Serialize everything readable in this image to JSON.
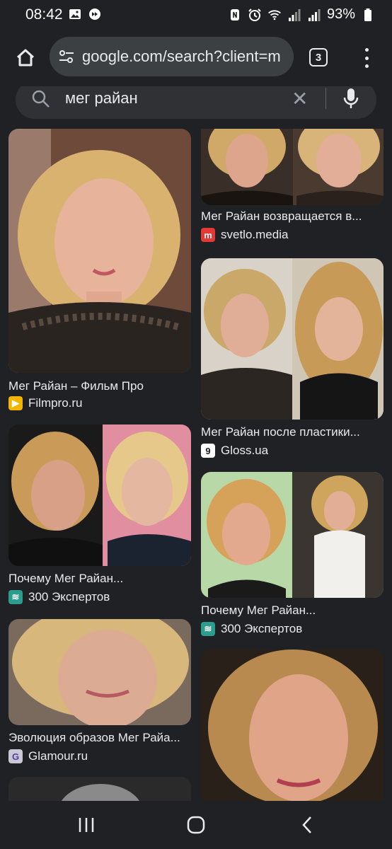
{
  "status_bar": {
    "time": "08:42",
    "battery": "93%",
    "left_icons": [
      "gallery-icon",
      "media-icon"
    ],
    "right_icons": [
      "nfc-icon",
      "alarm-icon",
      "wifi-icon",
      "signal-icon",
      "signal-icon",
      "battery-icon"
    ]
  },
  "address_bar": {
    "url": "google.com/search?client=m",
    "tab_count": "3"
  },
  "search": {
    "query": "мег райан",
    "clear_symbol": "✕"
  },
  "results": {
    "left": [
      {
        "caption": "Мег Райан – Фильм Про",
        "source": "Filmpro.ru",
        "favicon_letter": "▶",
        "favicon_color": "#f2b600"
      },
      {
        "caption": "Почему Мег Райан...",
        "source": "300 Экспертов",
        "favicon_letter": "≋",
        "favicon_color": "#2a9d8f"
      },
      {
        "caption": "Эволюция образов Мег Райа...",
        "source": "Glamour.ru",
        "favicon_letter": "G",
        "favicon_color": "#c9c9d6"
      }
    ],
    "right": [
      {
        "caption": "Мег Райан возвращается в...",
        "source": "svetlo.media",
        "favicon_letter": "m",
        "favicon_color": "#e53935"
      },
      {
        "caption": "Мег Райан после пластики...",
        "source": "Gloss.ua",
        "favicon_letter": "9",
        "favicon_color": "#ffffff"
      },
      {
        "caption": "Почему Мег Райан...",
        "source": "300 Экспертов",
        "favicon_letter": "≋",
        "favicon_color": "#2a9d8f"
      }
    ]
  },
  "colors": {
    "background": "#202124",
    "pill": "#3c4043",
    "searchbox": "#303134",
    "text": "#e8eaed"
  }
}
